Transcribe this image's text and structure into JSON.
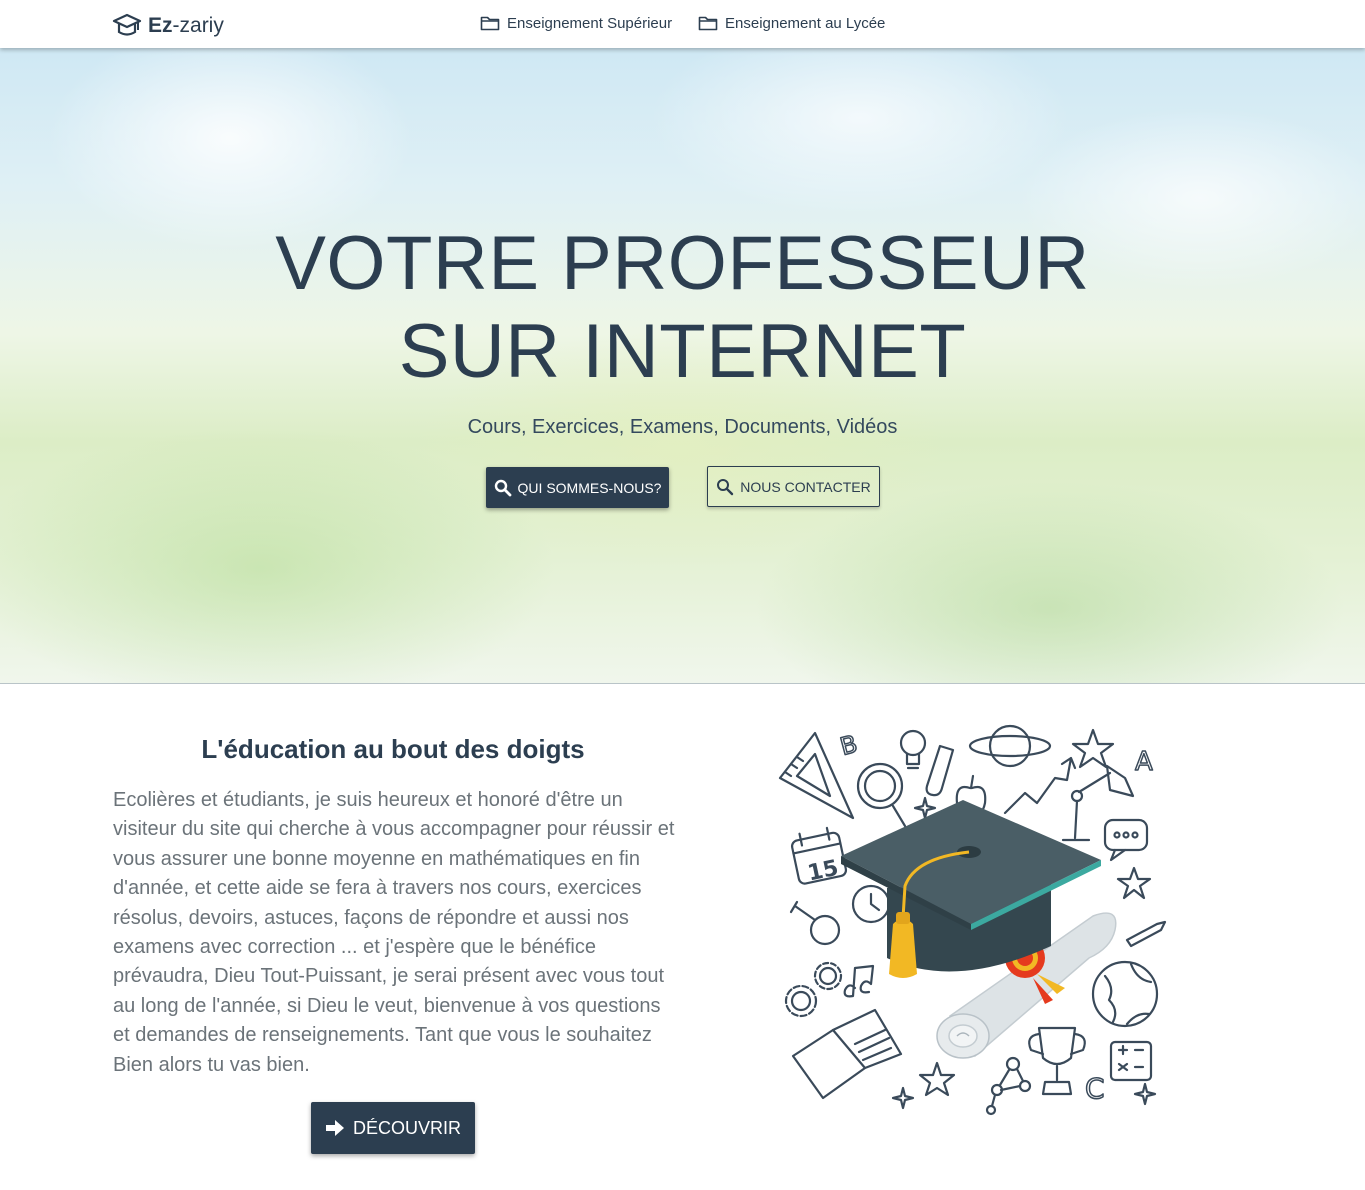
{
  "navbar": {
    "brand_strong": "Ez",
    "brand_rest": "-zariy",
    "links": [
      {
        "label": "Enseignement Supérieur",
        "icon": "folder-icon"
      },
      {
        "label": "Enseignement au Lycée",
        "icon": "folder-icon"
      }
    ]
  },
  "hero": {
    "title_line1": "VOTRE PROFESSEUR",
    "title_line2": "SUR INTERNET",
    "subtitle": "Cours, Exercices, Examens, Documents, Vidéos",
    "primary_button": "QUI SOMMES-NOUS?",
    "secondary_button": "NOUS CONTACTER"
  },
  "about": {
    "title": "L'éducation au bout des doigts",
    "text": "Ecolières et étudiants, je suis heureux et honoré d'être un visiteur du site qui cherche à vous accompagner pour réussir et vous assurer une bonne moyenne en mathématiques en fin d'année, et cette aide se fera à travers nos cours, exercices résolus, devoirs, astuces, façons de répondre et aussi nos examens avec correction ... et j'espère que le bénéfice prévaudra, Dieu Tout-Puissant, je serai présent avec vous tout au long de l'année, si Dieu le veut, bienvenue à vos questions et demandes de renseignements. Tant que vous le souhaitez Bien alors tu vas bien.",
    "button": "DÉCOUVRIR",
    "calendar_day": "15"
  },
  "colors": {
    "primary": "#2c3e50",
    "text_muted": "#6b7379",
    "cap_band": "#3ca9a0",
    "tassel": "#f2b824",
    "seal": "#e53a1e"
  }
}
